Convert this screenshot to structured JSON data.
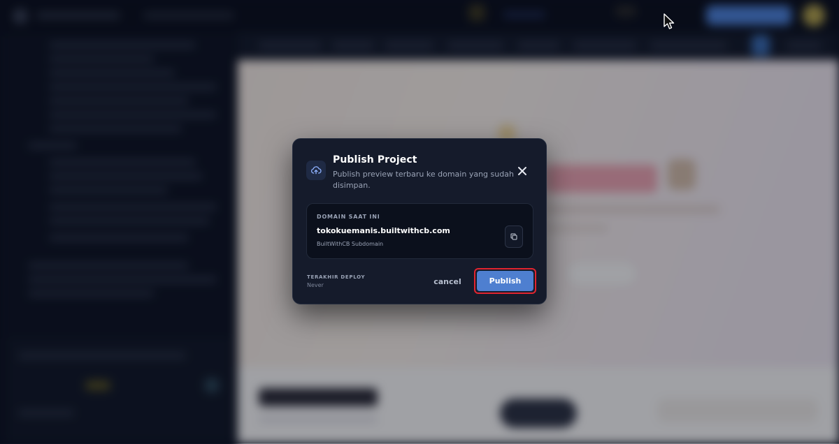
{
  "modal": {
    "title": "Publish Project",
    "description": "Publish preview terbaru ke domain yang sudah disimpan.",
    "icon": "cloud-upload-icon",
    "domain": {
      "label": "DOMAIN SAAT INI",
      "value": "tokokuemanis.builtwithcb.com",
      "type": "BuiltWithCB Subdomain"
    },
    "last_deploy": {
      "label": "TERAKHIR DEPLOY",
      "value": "Never"
    },
    "cancel_label": "cancel",
    "publish_label": "Publish"
  },
  "colors": {
    "modal_bg": "#151b2b",
    "publish_button": "#4e7fd0",
    "highlight_border": "#e3242f",
    "primary_text": "#ffffff",
    "muted_text": "#9aa3b6"
  }
}
